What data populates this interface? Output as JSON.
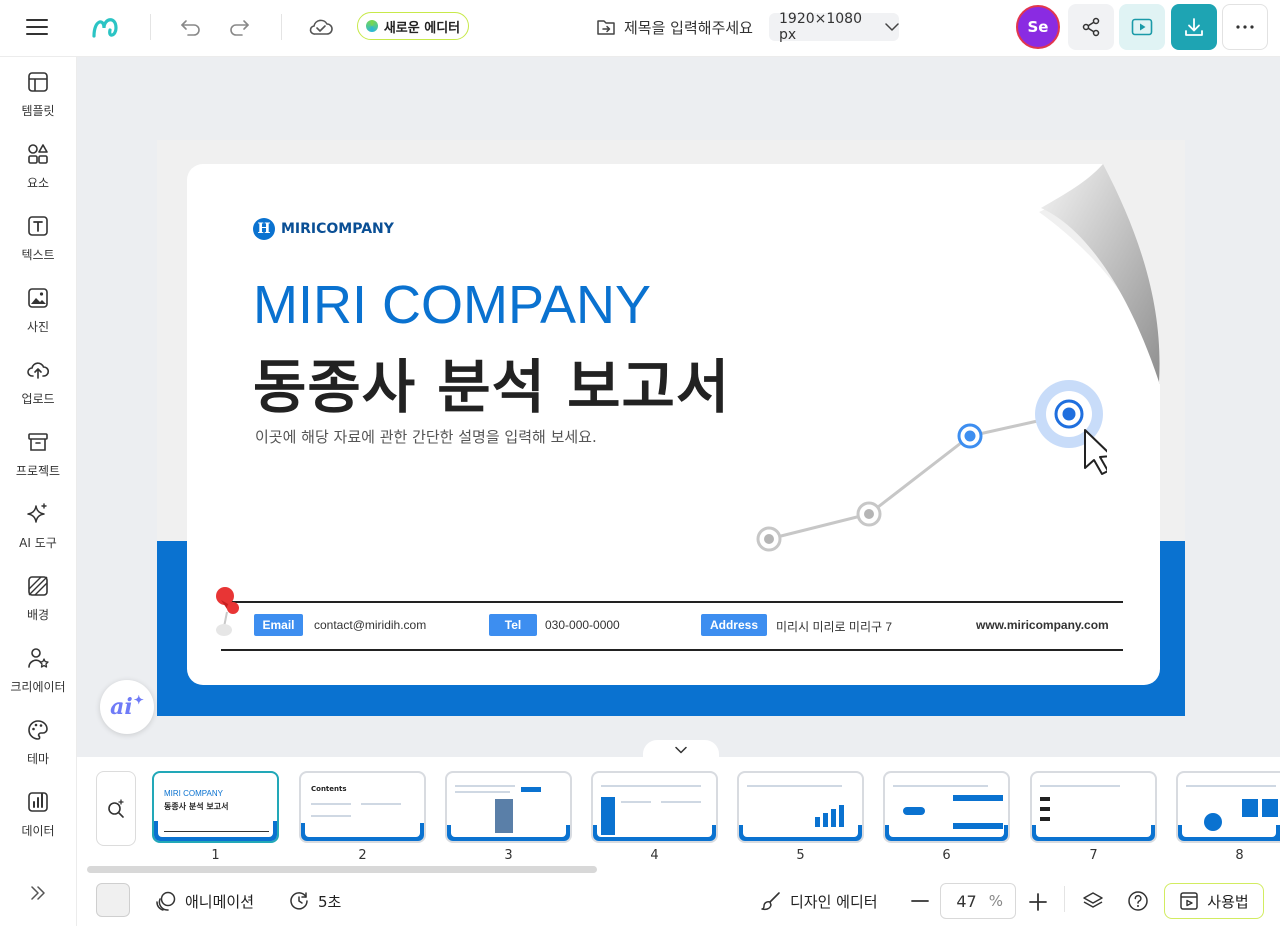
{
  "topbar": {
    "menu_icon": "hamburger-icon",
    "logo_icon": "miri-logo-icon",
    "undo_icon": "undo-icon",
    "redo_icon": "redo-icon",
    "save_status_icon": "cloud-check-icon",
    "new_editor_label": "새로운 에디터",
    "doc_title_placeholder": "제목을 입력해주세요",
    "size_select_value": "1920×1080 px",
    "avatar_initials": "Se",
    "share_icon": "share-icon",
    "play_icon": "play-icon",
    "download_icon": "download-icon",
    "more_icon": "more-icon"
  },
  "sidebar": {
    "items": [
      {
        "label": "템플릿",
        "icon": "template-icon"
      },
      {
        "label": "요소",
        "icon": "elements-icon"
      },
      {
        "label": "텍스트",
        "icon": "text-icon"
      },
      {
        "label": "사진",
        "icon": "photo-icon"
      },
      {
        "label": "업로드",
        "icon": "upload-icon"
      },
      {
        "label": "프로젝트",
        "icon": "project-icon"
      },
      {
        "label": "AI 도구",
        "icon": "ai-sparkle-icon"
      },
      {
        "label": "배경",
        "icon": "background-icon"
      },
      {
        "label": "크리에이터",
        "icon": "creator-icon"
      },
      {
        "label": "테마",
        "icon": "palette-icon"
      },
      {
        "label": "데이터",
        "icon": "data-chart-icon"
      }
    ],
    "expand_icon": "double-chevron-right-icon"
  },
  "slide": {
    "logo_text": "MIRICOMPANY",
    "logo_letter": "H",
    "title_en": "MIRI COMPANY",
    "title_ko": "동종사 분석 보고서",
    "subtitle": "이곳에 해당 자료에 관한 간단한 설명을 입력해 보세요.",
    "email_tag": "Email",
    "email_value": "contact@miridih.com",
    "tel_tag": "Tel",
    "tel_value": "030-000-0000",
    "address_tag": "Address",
    "address_value": "미리시 미리로 미리구 7",
    "website": "www.miricompany.com",
    "accent_color": "#0a72d0"
  },
  "ai_button_label": "ai",
  "pages": {
    "numbers": [
      "1",
      "2",
      "3",
      "4",
      "5",
      "6",
      "7",
      "8"
    ],
    "thumb1_title_en": "MIRI COMPANY",
    "thumb1_title_ko": "동종사 분석 보고서",
    "thumb2_title": "Contents",
    "active_page": "1"
  },
  "bottombar": {
    "animation_label": "애니메이션",
    "duration_label": "5초",
    "design_editor_label": "디자인 에디터",
    "zoom_value": "47",
    "zoom_unit": "%",
    "guide_label": "사용법"
  }
}
